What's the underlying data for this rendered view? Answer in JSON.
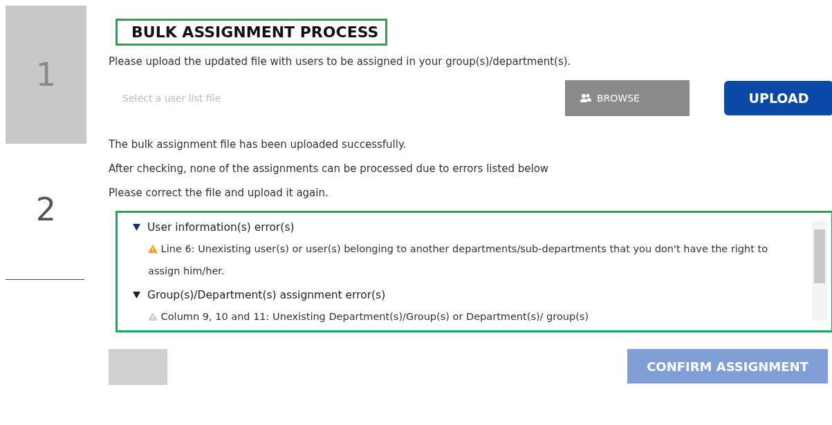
{
  "steps": [
    {
      "number": "1",
      "selected": true
    },
    {
      "number": "2",
      "selected": false
    }
  ],
  "title": "BULK ASSIGNMENT PROCESS",
  "instruction": "Please upload the updated file with users to be assigned in your group(s)/department(s).",
  "file_field": {
    "placeholder": "Select a user list file"
  },
  "browse_button": {
    "label": "BROWSE"
  },
  "upload_button": {
    "label": "UPLOAD"
  },
  "messages": [
    "The bulk assignment file has been uploaded successfully.",
    "After checking, none of the assignments can be processed due to errors listed below",
    "Please correct the file and upload it again."
  ],
  "error_groups": [
    {
      "title": "User information(s) error(s)",
      "expanded": true,
      "errors": [
        "Line 6: Unexisting user(s) or user(s) belonging to another departments/sub-departments that you don't have the right to assign him/her."
      ]
    },
    {
      "title": "Group(s)/Department(s) assignment error(s)",
      "expanded": true,
      "errors": [
        "Column 9, 10 and 11: Unexisting Department(s)/Group(s) or Department(s)/ group(s)"
      ]
    }
  ],
  "back_button": {
    "disabled": true
  },
  "confirm_button": {
    "label": "CONFIRM ASSIGNMENT",
    "disabled": true
  }
}
